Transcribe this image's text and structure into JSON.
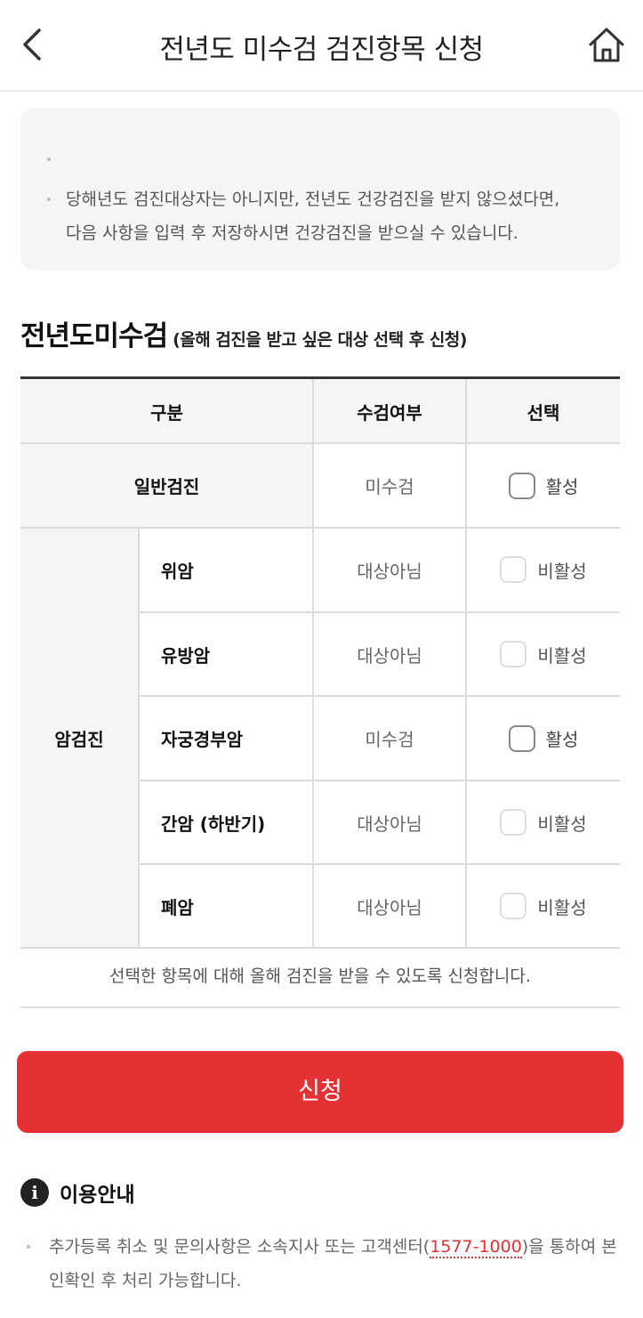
{
  "header": {
    "title": "전년도 미수검 검진항목 신청",
    "back_icon": "chevron-left-icon",
    "home_icon": "home-icon"
  },
  "notice": {
    "lines": [
      "당해년도 검진대상자는 아니지만, 전년도 건강검진을 받지 않으셨다면,",
      "다음 사항을 입력 후 저장하시면 건강검진을 받으실 수 있습니다."
    ]
  },
  "section": {
    "title": "전년도미수검",
    "subtitle": "(올해 검진을 받고 싶은 대상 선택 후 신청)"
  },
  "table": {
    "headers": [
      "구분",
      "수검여부",
      "선택"
    ],
    "general": {
      "label": "일반검진",
      "status": "미수검",
      "select_label": "활성",
      "enabled": true
    },
    "cancel_group": "암검진",
    "rows": [
      {
        "label": "위암",
        "status": "대상아님",
        "select_label": "비활성",
        "enabled": false
      },
      {
        "label": "유방암",
        "status": "대상아님",
        "select_label": "비활성",
        "enabled": false
      },
      {
        "label": "자궁경부암",
        "status": "미수검",
        "select_label": "활성",
        "enabled": true
      },
      {
        "label": "간암 (하반기)",
        "status": "대상아님",
        "select_label": "비활성",
        "enabled": false
      },
      {
        "label": "폐암",
        "status": "대상아님",
        "select_label": "비활성",
        "enabled": false
      }
    ],
    "note": "선택한 항목에 대해 올해 검진을 받을 수 있도록 신청합니다."
  },
  "submit_label": "신청",
  "info": {
    "title": "이용안내",
    "text_before": "추가등록 취소 및 문의사항은 소속지사 또는 고객센터(",
    "phone": "1577-1000",
    "text_after": ")을 통하여 본인확인 후 처리 가능합니다."
  },
  "colors": {
    "accent": "#e63134",
    "panel_bg": "#f5f5f6"
  }
}
